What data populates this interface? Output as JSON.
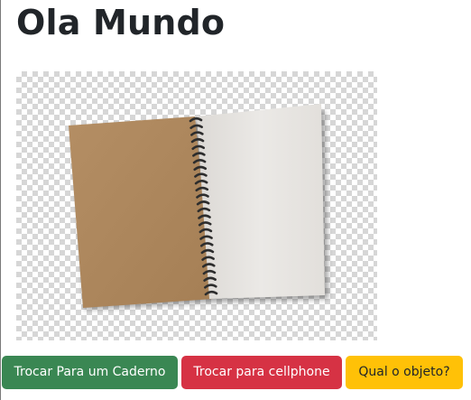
{
  "page": {
    "title": "Ola Mundo"
  },
  "image": {
    "subject": "notebook",
    "colors": {
      "cover": "#b08a5f",
      "page": "#e6e3df",
      "spiral": "#2d2d2d",
      "checker": "#d6d6d6"
    }
  },
  "buttons": {
    "swap_notebook": "Trocar Para um Caderno",
    "swap_cellphone": "Trocar para cellphone",
    "which_object": "Qual o objeto?",
    "colors": {
      "success": "#3a8753",
      "danger": "#d63244",
      "warning": "#ffc107"
    }
  }
}
